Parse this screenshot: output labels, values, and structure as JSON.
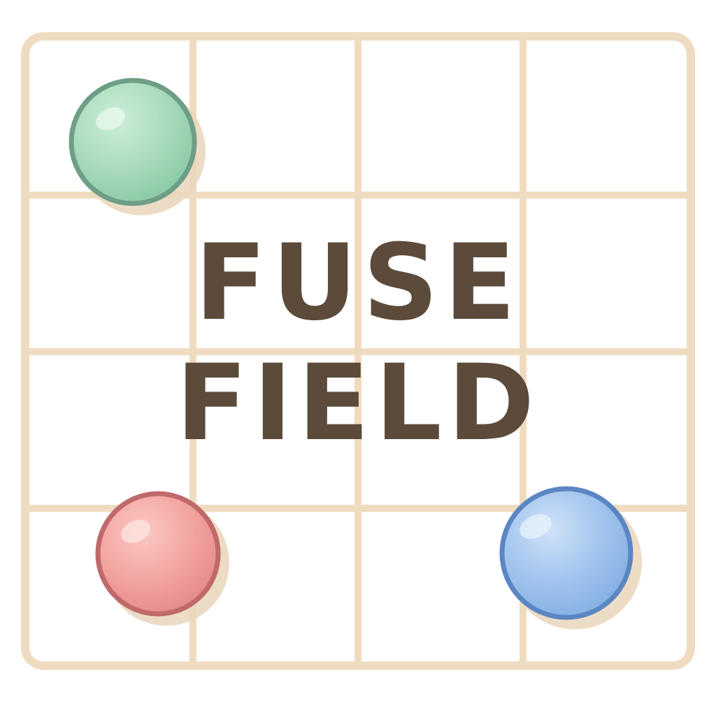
{
  "game": {
    "title_line_1": "FUSE",
    "title_line_2": "FIELD"
  },
  "board": {
    "rows": 4,
    "cols": 4,
    "frame_color": "#efdcc0",
    "cell_color": "#ffffff"
  },
  "orbs": [
    {
      "name": "green-orb",
      "color": "green",
      "fill": "#a9dcbc",
      "rim": "#6e9e86",
      "highlight": "#d8f1e0"
    },
    {
      "name": "red-orb",
      "color": "red",
      "fill": "#f2a3a2",
      "rim": "#c0696a",
      "highlight": "#fbd3d0"
    },
    {
      "name": "blue-orb",
      "color": "blue",
      "fill": "#9ec2ec",
      "rim": "#5b86c4",
      "highlight": "#d3e5f8"
    }
  ]
}
